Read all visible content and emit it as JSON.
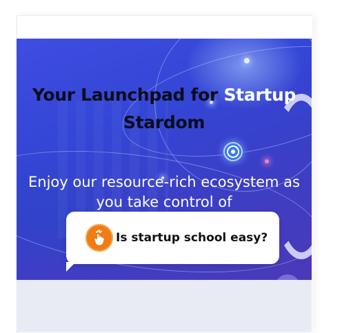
{
  "hero": {
    "heading_part1": "Your Launchpad for ",
    "heading_highlight": "Startup",
    "heading_part2": "Stardom",
    "subtext": "Enjoy our resource-rich ecosystem as you take control of"
  },
  "chat_widget": {
    "message": "Is startup school easy?",
    "icon": "hand-pointer-icon"
  },
  "colors": {
    "hero_blue": "#3f4de0",
    "highlight": "#ffffff",
    "chat_icon_orange": "#f07c14",
    "bottom_panel": "#e9ebf4"
  }
}
